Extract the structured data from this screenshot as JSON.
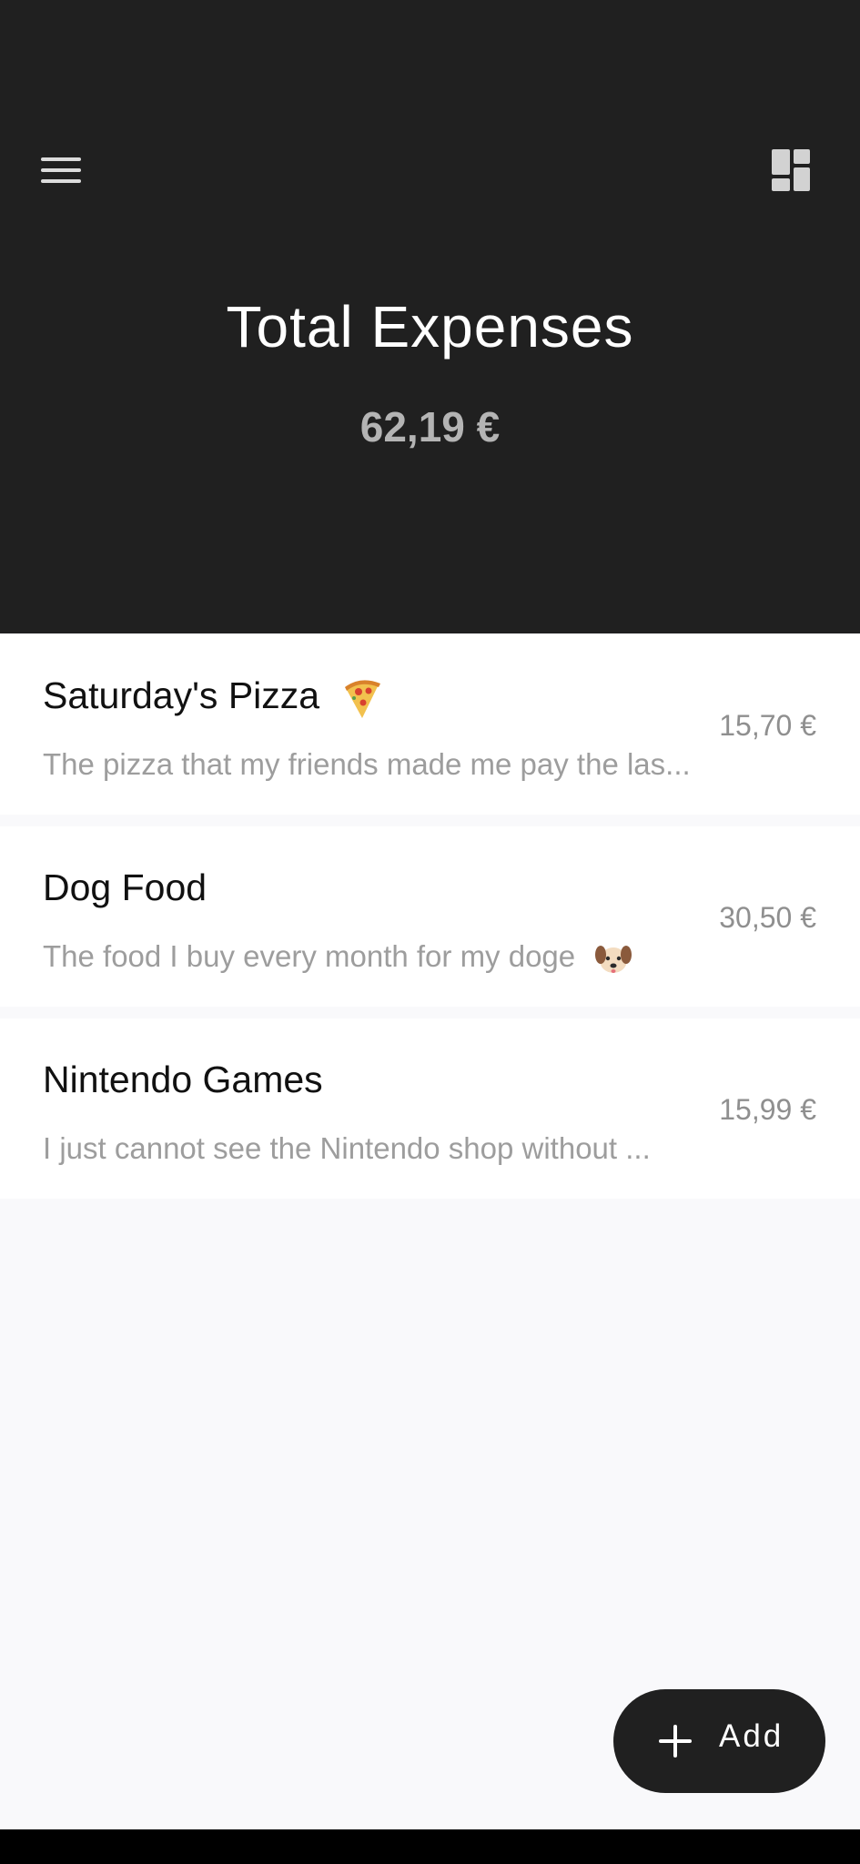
{
  "header": {
    "title": "Total Expenses",
    "total": "62,19 €"
  },
  "icons": {
    "menu": "menu-icon",
    "dashboard": "dashboard-icon",
    "pizza": "pizza-emoji-icon",
    "dog": "dog-face-emoji-icon",
    "add": "plus-icon"
  },
  "expenses": [
    {
      "title": "Saturday's Pizza",
      "description": "The pizza that my friends made me pay the las...",
      "amount": "15,70 €"
    },
    {
      "title": "Dog Food",
      "description": "The food I buy every month for my doge",
      "amount": "30,50 €"
    },
    {
      "title": "Nintendo Games",
      "description": "I just cannot see the Nintendo shop without ...",
      "amount": "15,99 €"
    }
  ],
  "fab": {
    "label": "Add"
  },
  "colors": {
    "header_bg": "#202020",
    "page_bg": "#f9f9fb",
    "card_bg": "#ffffff",
    "secondary_text": "#9d9d9d"
  }
}
